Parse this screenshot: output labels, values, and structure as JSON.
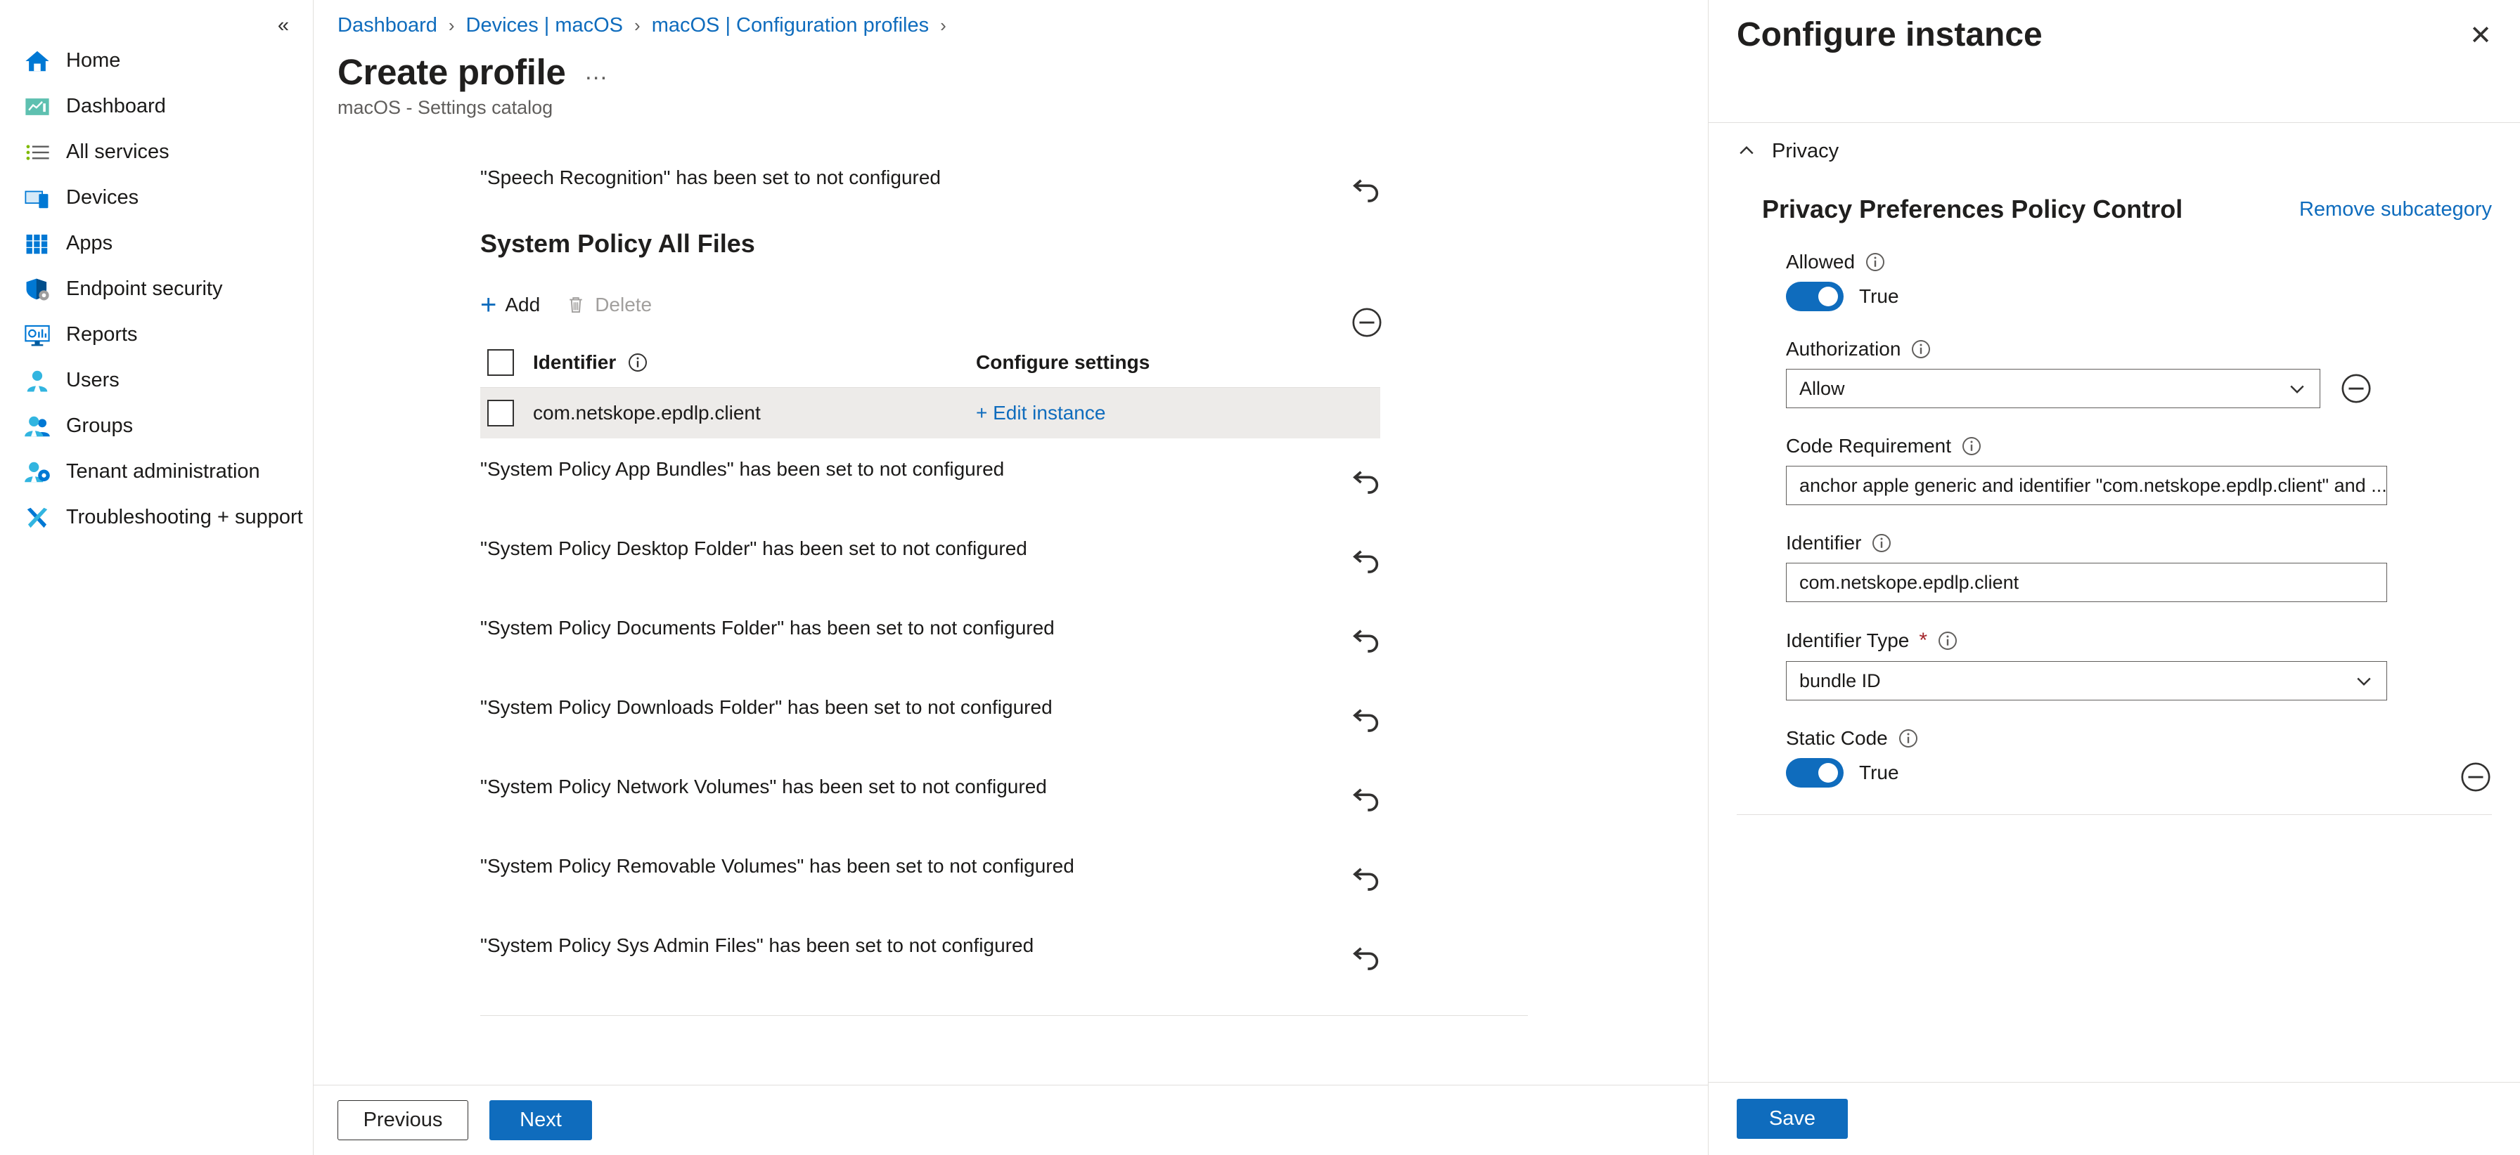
{
  "sidebar": {
    "collapse_icon": "chevron-double-left-icon",
    "items": [
      {
        "label": "Home",
        "icon": "home-icon"
      },
      {
        "label": "Dashboard",
        "icon": "dashboard-icon"
      },
      {
        "label": "All services",
        "icon": "all-services-icon"
      },
      {
        "label": "Devices",
        "icon": "devices-icon"
      },
      {
        "label": "Apps",
        "icon": "apps-grid-icon"
      },
      {
        "label": "Endpoint security",
        "icon": "shield-gear-icon"
      },
      {
        "label": "Reports",
        "icon": "reports-monitor-icon"
      },
      {
        "label": "Users",
        "icon": "user-icon"
      },
      {
        "label": "Groups",
        "icon": "groups-icon"
      },
      {
        "label": "Tenant administration",
        "icon": "tenant-admin-icon"
      },
      {
        "label": "Troubleshooting + support",
        "icon": "wrench-screwdriver-icon"
      }
    ]
  },
  "breadcrumb": [
    "Dashboard",
    "Devices | macOS",
    "macOS | Configuration profiles"
  ],
  "header": {
    "title": "Create profile",
    "subtitle": "macOS - Settings catalog",
    "more_icon": "ellipsis-icon"
  },
  "main": {
    "top_setting": {
      "text": "\"Speech Recognition\" has been set to not configured",
      "revert_icon": "undo-arrow-icon"
    },
    "group": {
      "title": "System Policy All Files",
      "toolbar": {
        "add_label": "Add",
        "add_icon": "plus-icon",
        "delete_label": "Delete",
        "delete_icon": "trash-icon"
      },
      "table": {
        "columns": [
          "Identifier",
          "Configure settings"
        ],
        "identifier_info_icon": "info-icon",
        "rows": [
          {
            "identifier": "com.netskope.epdlp.client",
            "configure": "+ Edit instance"
          }
        ]
      },
      "remove_icon": "minus-circle-icon"
    },
    "settings": [
      {
        "text": "\"System Policy App Bundles\" has been set to not configured",
        "revert_icon": "undo-arrow-icon"
      },
      {
        "text": "\"System Policy Desktop Folder\" has been set to not configured",
        "revert_icon": "undo-arrow-icon"
      },
      {
        "text": "\"System Policy Documents Folder\" has been set to not configured",
        "revert_icon": "undo-arrow-icon"
      },
      {
        "text": "\"System Policy Downloads Folder\" has been set to not configured",
        "revert_icon": "undo-arrow-icon"
      },
      {
        "text": "\"System Policy Network Volumes\" has been set to not configured",
        "revert_icon": "undo-arrow-icon"
      },
      {
        "text": "\"System Policy Removable Volumes\" has been set to not configured",
        "revert_icon": "undo-arrow-icon"
      },
      {
        "text": "\"System Policy Sys Admin Files\" has been set to not configured",
        "revert_icon": "undo-arrow-icon"
      }
    ],
    "footer": {
      "previous_label": "Previous",
      "next_label": "Next"
    }
  },
  "panel": {
    "title": "Configure instance",
    "close_icon": "close-icon",
    "accordion": {
      "label": "Privacy",
      "icon": "chevron-up-icon",
      "expanded": true
    },
    "subcategory": {
      "title": "Privacy Preferences Policy Control",
      "remove_label": "Remove subcategory"
    },
    "fields": [
      {
        "label": "Allowed",
        "type": "toggle",
        "value": "True",
        "info_icon": "info-icon"
      },
      {
        "label": "Authorization",
        "type": "select",
        "value": "Allow",
        "info_icon": "info-icon",
        "chevron_icon": "chevron-down-icon",
        "remove_icon": "minus-circle-icon"
      },
      {
        "label": "Code Requirement",
        "type": "text",
        "value": "anchor apple generic and identifier \"com.netskope.epdlp.client\" and ...",
        "info_icon": "info-icon"
      },
      {
        "label": "Identifier",
        "type": "text",
        "value": "com.netskope.epdlp.client",
        "info_icon": "info-icon"
      },
      {
        "label": "Identifier Type",
        "type": "select",
        "value": "bundle ID",
        "required": "*",
        "info_icon": "info-icon",
        "chevron_icon": "chevron-down-icon"
      },
      {
        "label": "Static Code",
        "type": "toggle",
        "value": "True",
        "info_icon": "info-icon",
        "remove_icon": "minus-circle-icon"
      }
    ],
    "footer": {
      "save_label": "Save"
    }
  },
  "colors": {
    "accent": "#0f6cbd",
    "link": "#0f6cbd",
    "row_selected_bg": "#edebe9",
    "border": "#e1dfdd",
    "required": "#a4262c"
  }
}
